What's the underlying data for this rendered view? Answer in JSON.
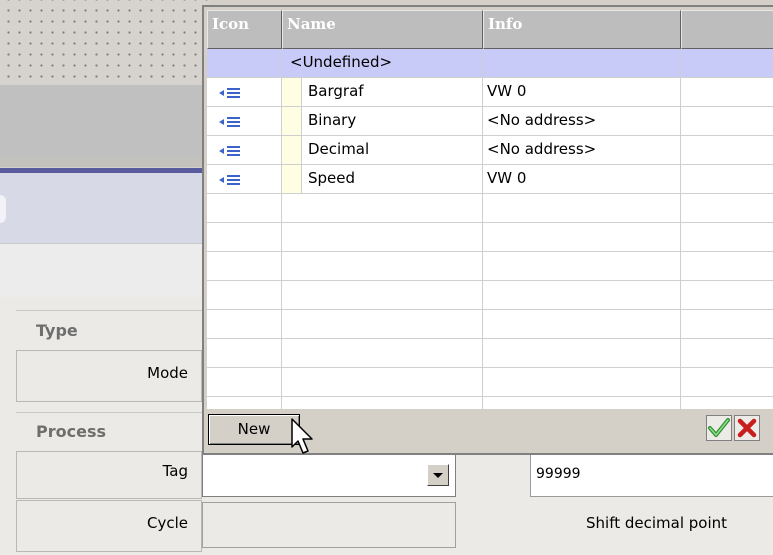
{
  "popup": {
    "columns": [
      "Icon",
      "Name",
      "Info",
      ""
    ],
    "rows": [
      {
        "name": "<Undefined>",
        "info": "",
        "icon": ""
      },
      {
        "name": "Bargraf",
        "info": "VW 0",
        "icon": "tag-icon"
      },
      {
        "name": "Binary",
        "info": "<No address>",
        "icon": "tag-icon"
      },
      {
        "name": "Decimal",
        "info": "<No address>",
        "icon": "tag-icon"
      },
      {
        "name": "Speed",
        "info": "VW 0",
        "icon": "tag-icon"
      }
    ],
    "new_label": "New",
    "ok_icon": "checkmark-icon",
    "cancel_icon": "cross-icon"
  },
  "properties": {
    "type_section": "Type",
    "mode_label": "Mode",
    "process_section": "Process",
    "tag_label": "Tag",
    "cycle_label": "Cycle",
    "value": "99999",
    "shift_decimal_label": "Shift decimal point"
  },
  "colors": {
    "undefined_row": "#c8cbf7",
    "header_bg": "#bdbdbd",
    "tag_icon": "#3b63c8"
  }
}
